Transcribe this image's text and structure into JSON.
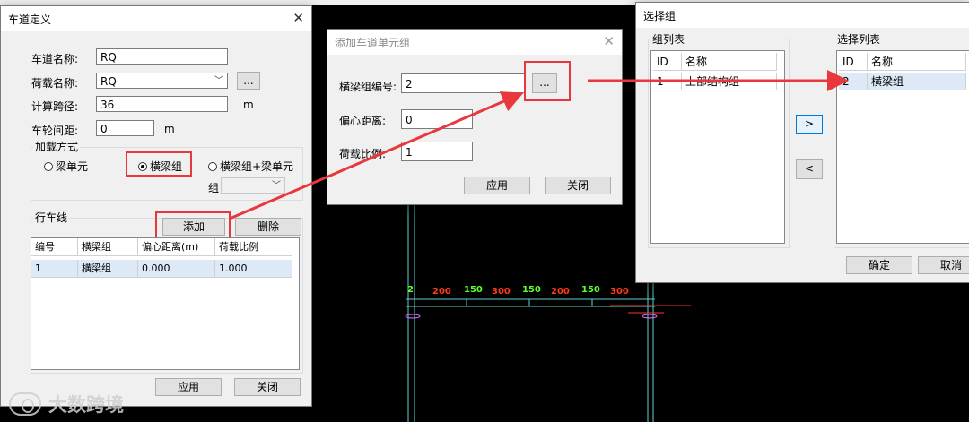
{
  "background": "#000000",
  "accent": "#e8383d",
  "lane_dialog": {
    "title": "车道定义",
    "close_icon": "close-icon",
    "fields": {
      "lane_name_label": "车道名称:",
      "lane_name_value": "RQ",
      "load_name_label": "荷载名称:",
      "load_name_value": "RQ",
      "load_browse_label": "...",
      "span_label": "计算跨径:",
      "span_value": "36",
      "span_unit": "m",
      "wheel_label": "车轮间距:",
      "wheel_value": "0",
      "wheel_unit": "m"
    },
    "loading_mode": {
      "title": "加载方式",
      "options": [
        "梁单元",
        "横梁组",
        "横梁组+梁单元"
      ],
      "selected": "横梁组",
      "group_label": "组"
    },
    "traffic_line": {
      "title": "行车线",
      "add_label": "添加",
      "delete_label": "删除",
      "columns": [
        "编号",
        "横梁组",
        "偏心距离(m)",
        "荷载比例"
      ],
      "rows": [
        [
          "1",
          "横梁组",
          "0.000",
          "1.000"
        ]
      ]
    },
    "apply_label": "应用",
    "close_label": "关闭"
  },
  "add_unit_dialog": {
    "title": "添加车道单元组",
    "close_icon": "close-icon",
    "group_no_label": "横梁组编号:",
    "group_no_value": "2",
    "browse_label": "...",
    "eccentric_label": "偏心距离:",
    "eccentric_value": "0",
    "ratio_label": "荷载比例:",
    "ratio_value": "1",
    "apply_label": "应用",
    "close_label": "关闭"
  },
  "select_dialog": {
    "title": "选择组",
    "group_list": {
      "title": "组列表",
      "columns": [
        "ID",
        "名称"
      ],
      "rows": [
        [
          "1",
          "上部结构组"
        ]
      ]
    },
    "selected_list": {
      "title": "选择列表",
      "columns": [
        "ID",
        "名称"
      ],
      "rows": [
        [
          "2",
          "横梁组"
        ]
      ]
    },
    "move_right_label": ">",
    "move_left_label": "<",
    "ok_label": "确定",
    "cancel_label": "取消"
  },
  "cad_labels": [
    {
      "text": "200",
      "color": "#ff3b1a"
    },
    {
      "text": "150",
      "color": "#5cff2a"
    },
    {
      "text": "300",
      "color": "#ff3b1a"
    },
    {
      "text": "150",
      "color": "#5cff2a"
    },
    {
      "text": "200",
      "color": "#ff3b1a"
    },
    {
      "text": "150",
      "color": "#5cff2a"
    },
    {
      "text": "300",
      "color": "#ff3b1a"
    }
  ],
  "watermark": "大数跨境"
}
